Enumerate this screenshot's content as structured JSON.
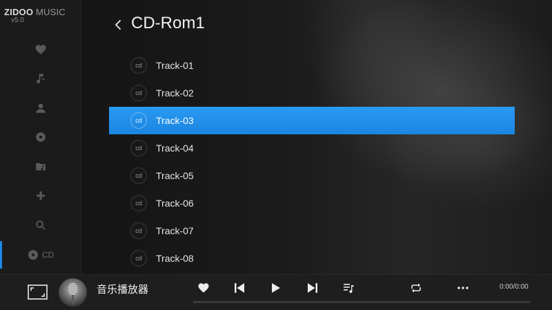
{
  "app": {
    "brand_main": "ZIDOO",
    "brand_sub": " MUSIC",
    "version": "v5.0"
  },
  "sidebar": {
    "items": [
      {
        "icon": "heart-icon"
      },
      {
        "icon": "music-note-icon"
      },
      {
        "icon": "person-icon"
      },
      {
        "icon": "album-disc-icon"
      },
      {
        "icon": "folder-music-icon"
      },
      {
        "icon": "plus-icon"
      },
      {
        "icon": "search-icon"
      },
      {
        "icon": "cd-icon",
        "label": "CD",
        "active": true
      }
    ]
  },
  "header": {
    "back_icon": "chevron-left-icon",
    "title": "CD-Rom1"
  },
  "tracks": [
    {
      "badge": "cd",
      "name": "Track-01",
      "selected": false
    },
    {
      "badge": "cd",
      "name": "Track-02",
      "selected": false
    },
    {
      "badge": "cd",
      "name": "Track-03",
      "selected": true
    },
    {
      "badge": "cd",
      "name": "Track-04",
      "selected": false
    },
    {
      "badge": "cd",
      "name": "Track-05",
      "selected": false
    },
    {
      "badge": "cd",
      "name": "Track-06",
      "selected": false
    },
    {
      "badge": "cd",
      "name": "Track-07",
      "selected": false
    },
    {
      "badge": "cd",
      "name": "Track-08",
      "selected": false
    }
  ],
  "player": {
    "song_title": "音乐播放器",
    "time": "0:00/0:00",
    "progress": 0,
    "buttons": [
      "fullscreen-icon",
      "heart-icon",
      "skip-previous-icon",
      "play-icon",
      "skip-next-icon",
      "playlist-icon",
      "repeat-icon",
      "more-icon"
    ]
  },
  "colors": {
    "accent": "#1e88e5",
    "selected_row": "#2a9af3",
    "sidebar_bg": "#1b1b1b",
    "player_bg": "#1e1e1e"
  }
}
